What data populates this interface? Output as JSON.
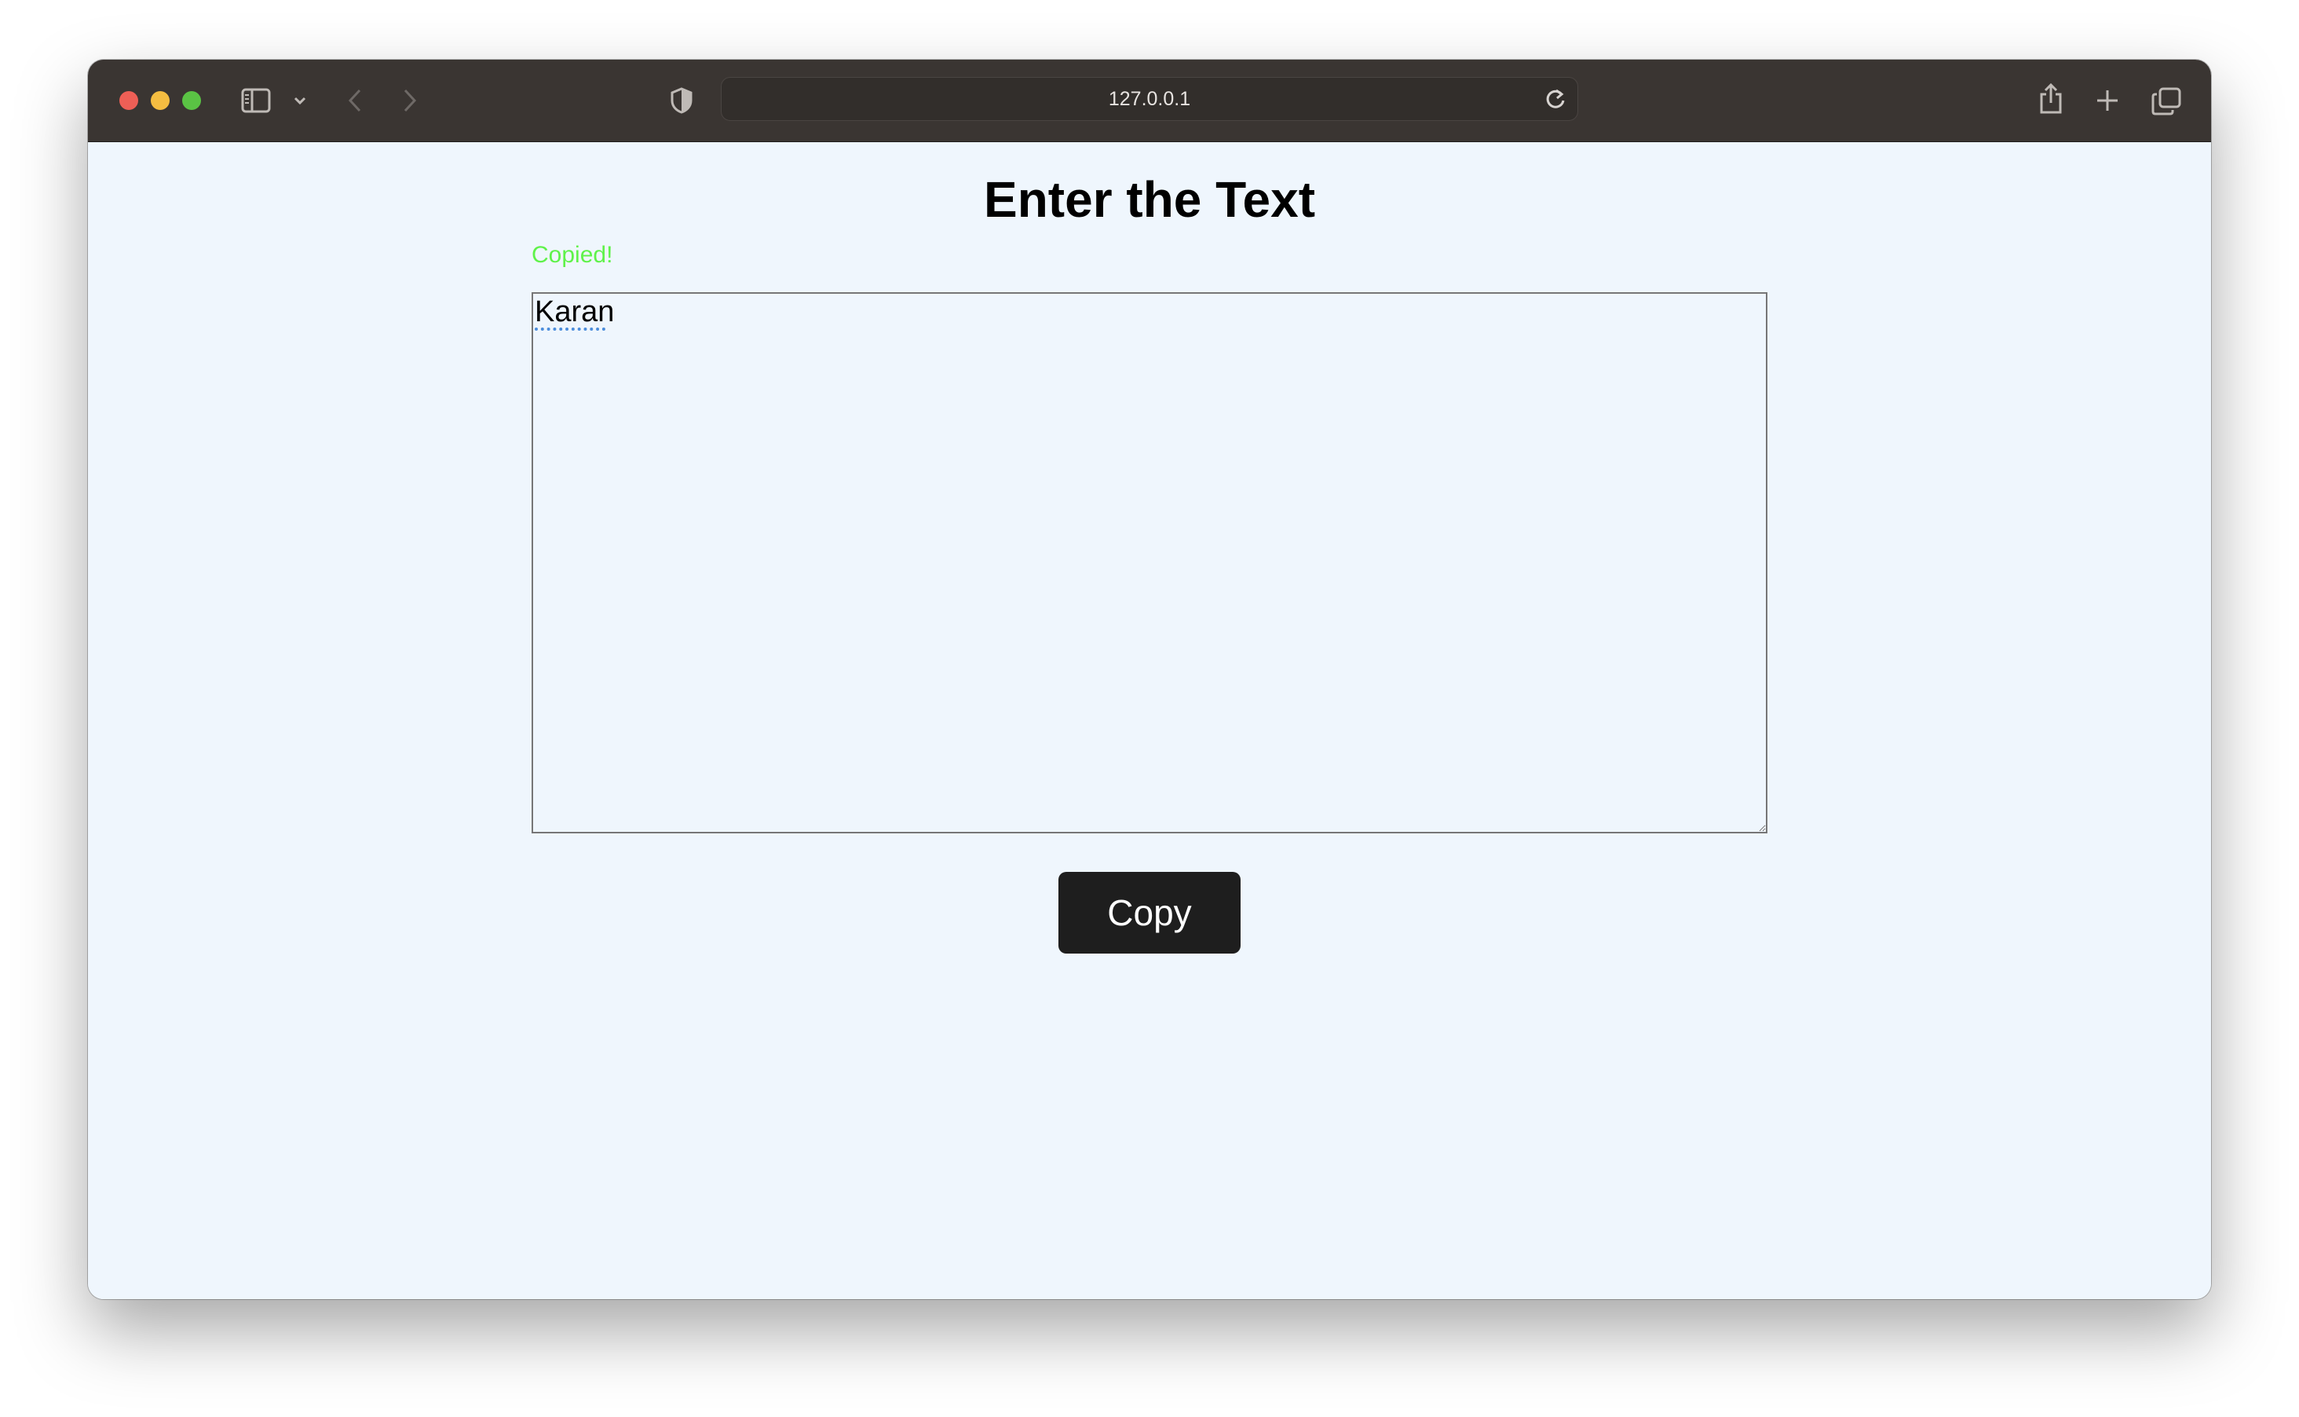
{
  "browser": {
    "url": "127.0.0.1",
    "icons": {
      "sidebar": "sidebar-icon",
      "sidebar_menu": "chevron-down-icon",
      "back": "chevron-left-icon",
      "forward": "chevron-right-icon",
      "privacy": "shield-icon",
      "reload": "reload-icon",
      "share": "share-icon",
      "new_tab": "plus-icon",
      "tabs": "tab-overview-icon"
    }
  },
  "page": {
    "title": "Enter the Text",
    "status": "Copied!",
    "textarea_value": "Karan",
    "copy_button": "Copy"
  },
  "colors": {
    "page_background": "#eff6fd",
    "status_text": "#5ff24a",
    "button_background": "#1e1e1e",
    "titlebar": "#3a3532"
  }
}
